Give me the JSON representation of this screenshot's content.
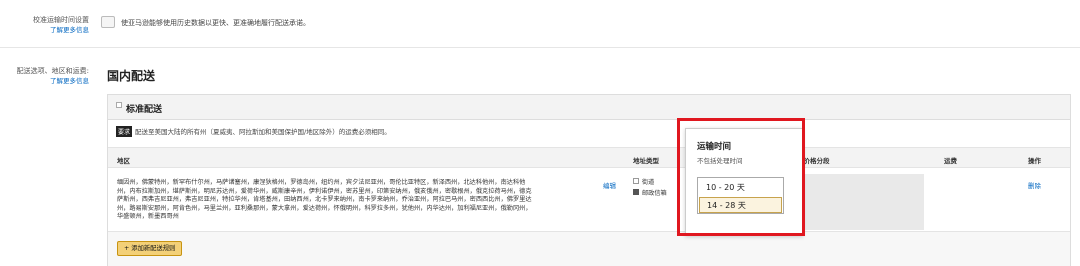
{
  "cutoff": {
    "label": "校准运输时间设置",
    "learn_more": "了解更多信息",
    "description": "使亚马逊能够使用历史数据以更快、更准确地履行配送承诺。"
  },
  "shipping": {
    "label": "配送选项、地区和运费:",
    "learn_more": "了解更多信息",
    "section_title": "国内配送",
    "standard": {
      "title": "标准配送",
      "badge": "要求",
      "notice": "配送至美国大陆的所有州（夏威夷、阿拉斯加和美国保护国/地区除外）的运费必须相同。",
      "columns": {
        "region": "地区",
        "address_type": "地址类型",
        "price_tier": "按价格分段",
        "fee": "运费",
        "action": "操作"
      },
      "row": {
        "regions": "缅因州，佛蒙特州，新罕布什尔州，马萨诸塞州，康涅狄格州，罗德岛州，纽约州，宾夕法尼亚州，哥伦比亚特区，新泽西州，北达科他州，南达科他州，内布拉斯加州，堪萨斯州，明尼苏达州，爱荷华州，威斯康辛州，伊利诺伊州，密苏里州，印第安纳州，俄亥俄州，密歇根州，俄克拉荷马州，德克萨斯州，西弗吉尼亚州，弗吉尼亚州，特拉华州，肯塔基州，田纳西州，北卡罗来纳州，南卡罗来纳州，乔治亚州，阿拉巴马州，密西西比州，佛罗里达州，路易斯安那州，阿肯色州，马里兰州，亚利桑那州，蒙大拿州，爱达荷州，怀俄明州，科罗拉多州，犹他州，内华达州，加利福尼亚州，俄勒冈州，华盛顿州，新墨西哥州",
        "edit": "编辑",
        "address_options": [
          {
            "label": "街道",
            "checked": false
          },
          {
            "label": "邮政信箱",
            "checked": true
          }
        ],
        "delete": "删除"
      },
      "add_rule": "+ 添加新配送规则"
    }
  },
  "transit_popover": {
    "title": "运输时间",
    "subtitle": "不包括处理时间",
    "options": [
      "10 - 20 天",
      "14 - 28 天"
    ],
    "selected": "14 - 28 天"
  },
  "colors": {
    "highlight_border": "#e0171f",
    "link": "#0066c0",
    "button": "#f3d078"
  }
}
